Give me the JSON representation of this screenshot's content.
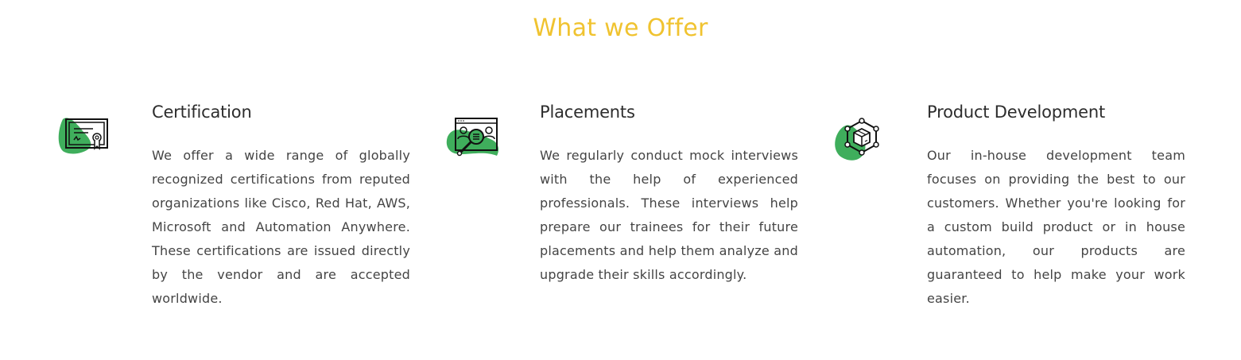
{
  "section": {
    "title": "What we Offer"
  },
  "colors": {
    "title": "#f0c330",
    "icon_blob": "#3fae5c",
    "icon_stroke": "#111111"
  },
  "offers": [
    {
      "icon": "certificate-icon",
      "title": "Certification",
      "text": "We offer a wide range of globally recognized certifications from reputed organizations like Cisco, Red Hat, AWS, Microsoft and Automation Anywhere. These certifications are issued directly by the vendor and are accepted worldwide."
    },
    {
      "icon": "interview-search-icon",
      "title": "Placements",
      "text": "We regularly conduct mock interviews with the help of experienced professionals. These interviews help prepare our trainees for their future placements and help them analyze and upgrade their skills accordingly."
    },
    {
      "icon": "product-cube-icon",
      "title": "Product Development",
      "text": "Our in-house development team focuses on providing the best to our customers. Whether you're looking for a custom build product or in house automation, our products are guaranteed to help make your work easier."
    }
  ]
}
